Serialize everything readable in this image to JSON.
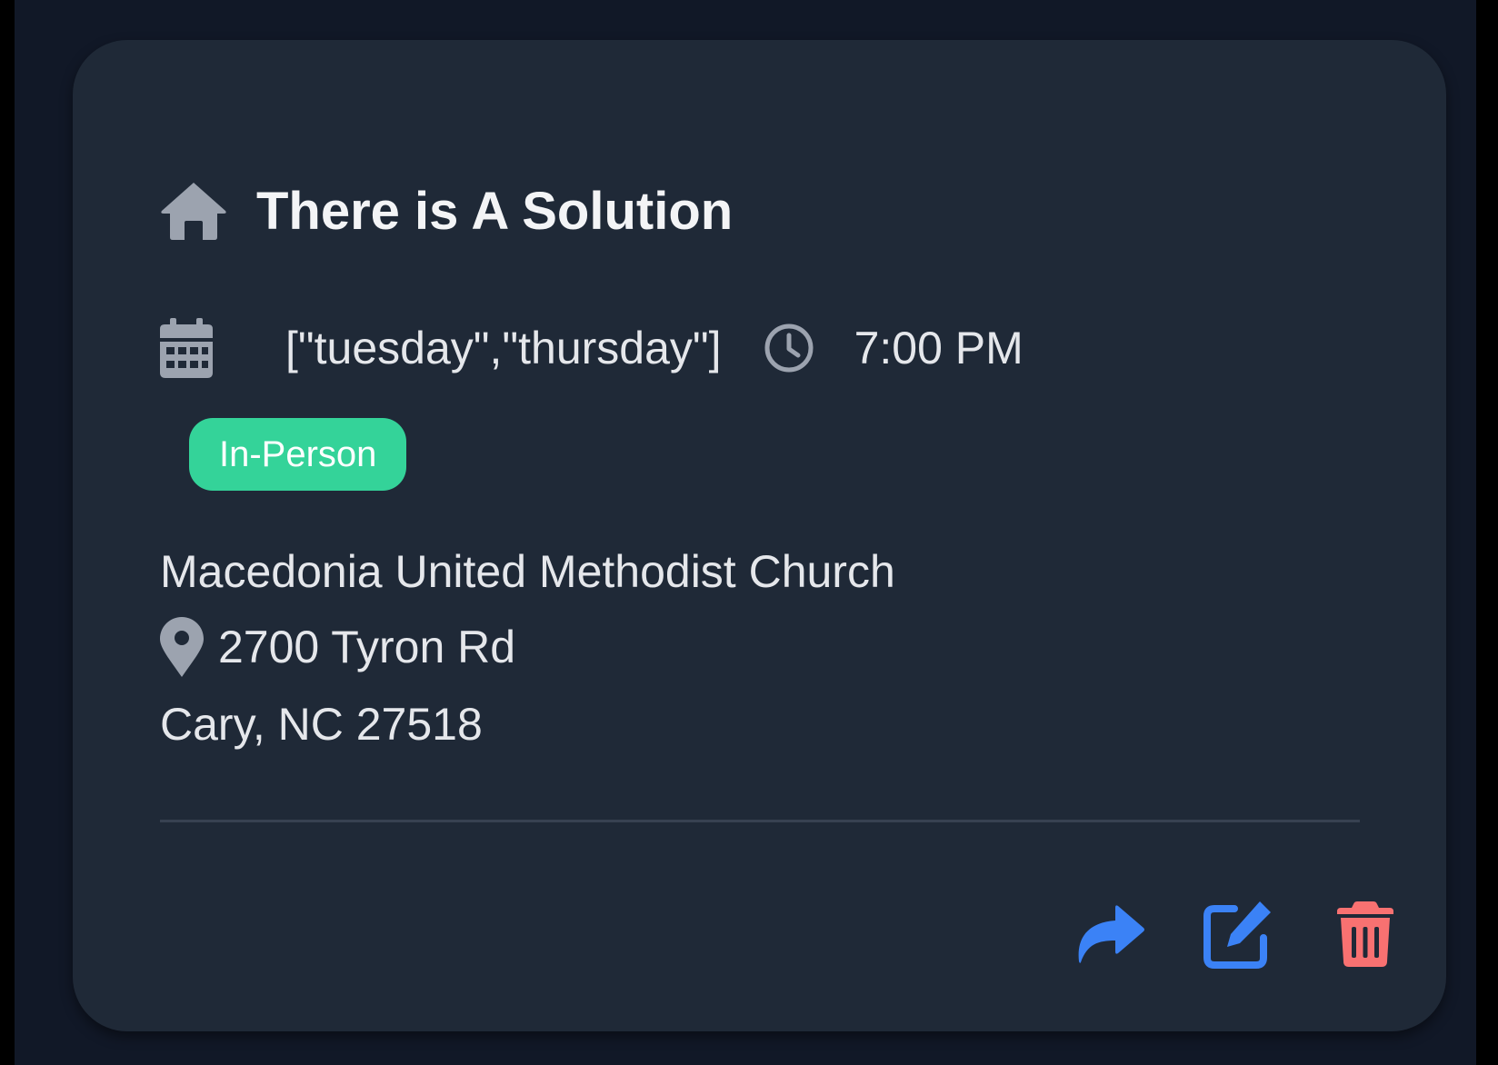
{
  "card": {
    "title": "There is A Solution",
    "title_icon": "home-icon",
    "schedule": {
      "days": "[\"tuesday\",\"thursday\"]",
      "days_icon": "calendar-icon",
      "time": "7:00 PM",
      "time_icon": "clock-icon"
    },
    "badge": {
      "label": "In-Person",
      "color": "#34d399"
    },
    "location": {
      "venue": "Macedonia United Methodist Church",
      "street": "2700 Tyron Rd",
      "street_icon": "map-pin-icon",
      "city_line": "Cary, NC 27518"
    },
    "actions": [
      {
        "name": "share",
        "icon": "share-icon",
        "color": "#3b82f6"
      },
      {
        "name": "edit",
        "icon": "edit-icon",
        "color": "#3b82f6"
      },
      {
        "name": "delete",
        "icon": "trash-icon",
        "color": "#f87171"
      }
    ]
  },
  "colors": {
    "background": "#111827",
    "card": "#1f2937",
    "text": "#e5e7eb",
    "icon_muted": "#9ca3af"
  }
}
